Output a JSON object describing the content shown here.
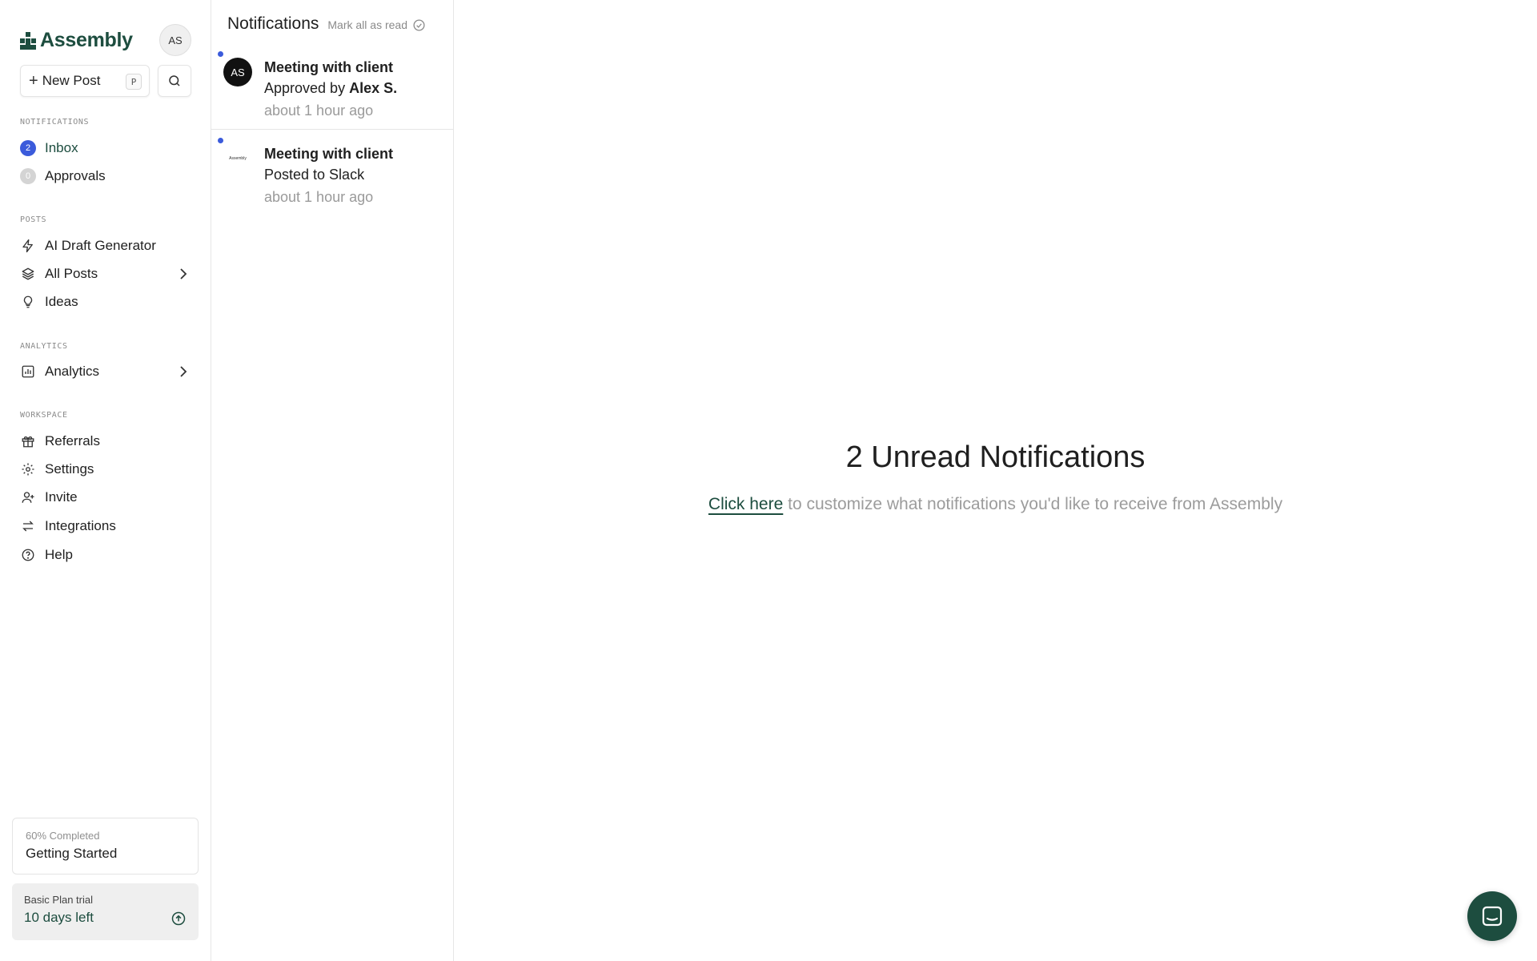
{
  "brand": {
    "name": "Assembly",
    "color": "#1d4d3f"
  },
  "user": {
    "initials": "AS"
  },
  "new_post": {
    "label": "New Post",
    "shortcut": "P"
  },
  "sections": {
    "notifications": "NOTIFICATIONS",
    "posts": "POSTS",
    "analytics": "ANALYTICS",
    "workspace": "WORKSPACE"
  },
  "nav": {
    "inbox": {
      "label": "Inbox",
      "count": "2",
      "badge_color": "#3b5bdb"
    },
    "approvals": {
      "label": "Approvals",
      "count": "0",
      "badge_color": "#cfcfcf"
    },
    "ai_draft": {
      "label": "AI Draft Generator",
      "icon": "lightning-icon"
    },
    "all_posts": {
      "label": "All Posts",
      "icon": "layers-icon"
    },
    "ideas": {
      "label": "Ideas",
      "icon": "lightbulb-icon"
    },
    "analytics": {
      "label": "Analytics",
      "icon": "chart-icon"
    },
    "referrals": {
      "label": "Referrals",
      "icon": "gift-icon"
    },
    "settings": {
      "label": "Settings",
      "icon": "gear-icon"
    },
    "invite": {
      "label": "Invite",
      "icon": "user-plus-icon"
    },
    "integrations": {
      "label": "Integrations",
      "icon": "arrows-swap-icon"
    },
    "help": {
      "label": "Help",
      "icon": "help-circle-icon"
    }
  },
  "progress_card": {
    "percent_label": "60% Completed",
    "percent": 60,
    "title": "Getting Started"
  },
  "plan_card": {
    "label": "Basic Plan trial",
    "days_left": "10 days left"
  },
  "notifications_panel": {
    "title": "Notifications",
    "mark_all": "Mark all as read",
    "items": [
      {
        "title": "Meeting with client",
        "desc_prefix": "Approved by",
        "desc_strong": "Alex S.",
        "time": "about 1 hour ago",
        "avatar_initials": "AS",
        "unread": true
      },
      {
        "title": "Meeting with client",
        "desc_prefix": "Posted to Slack",
        "desc_strong": "",
        "time": "about 1 hour ago",
        "avatar_initials": "Assembly",
        "unread": true
      }
    ]
  },
  "main": {
    "title": "2 Unread Notifications",
    "link_text": "Click here",
    "subtitle_rest": " to customize what notifications you'd like to receive from Assembly"
  },
  "colors": {
    "accent": "#1d4d3f",
    "unread_dot": "#3b5bdb"
  }
}
